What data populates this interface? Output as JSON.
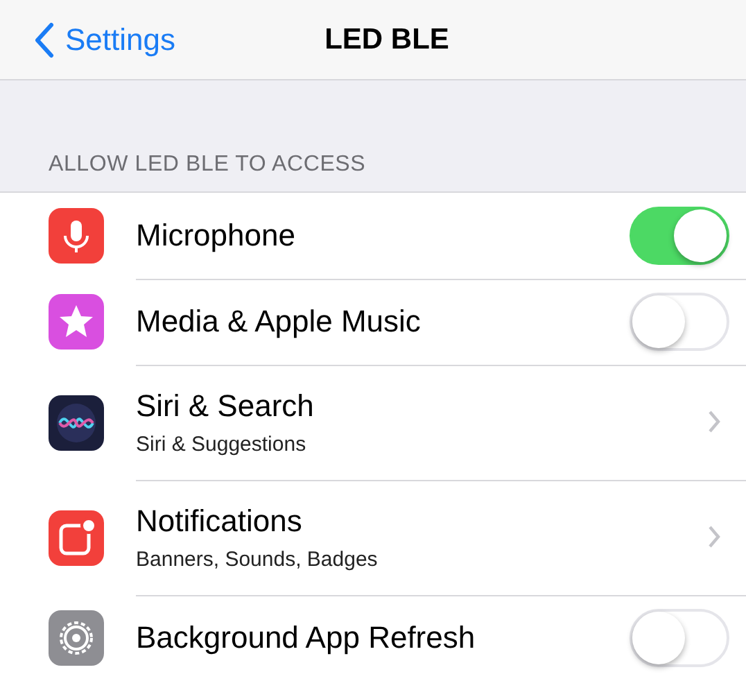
{
  "nav": {
    "back": "Settings",
    "title": "LED BLE"
  },
  "section_header": "ALLOW LED BLE TO ACCESS",
  "rows": [
    {
      "kind": "toggle",
      "title": "Microphone",
      "on": true
    },
    {
      "kind": "toggle",
      "title": "Media & Apple Music",
      "on": false
    },
    {
      "kind": "link",
      "title": "Siri & Search",
      "subtitle": "Siri & Suggestions"
    },
    {
      "kind": "link",
      "title": "Notifications",
      "subtitle": "Banners, Sounds, Badges"
    },
    {
      "kind": "toggle",
      "title": "Background App Refresh",
      "on": false
    }
  ]
}
